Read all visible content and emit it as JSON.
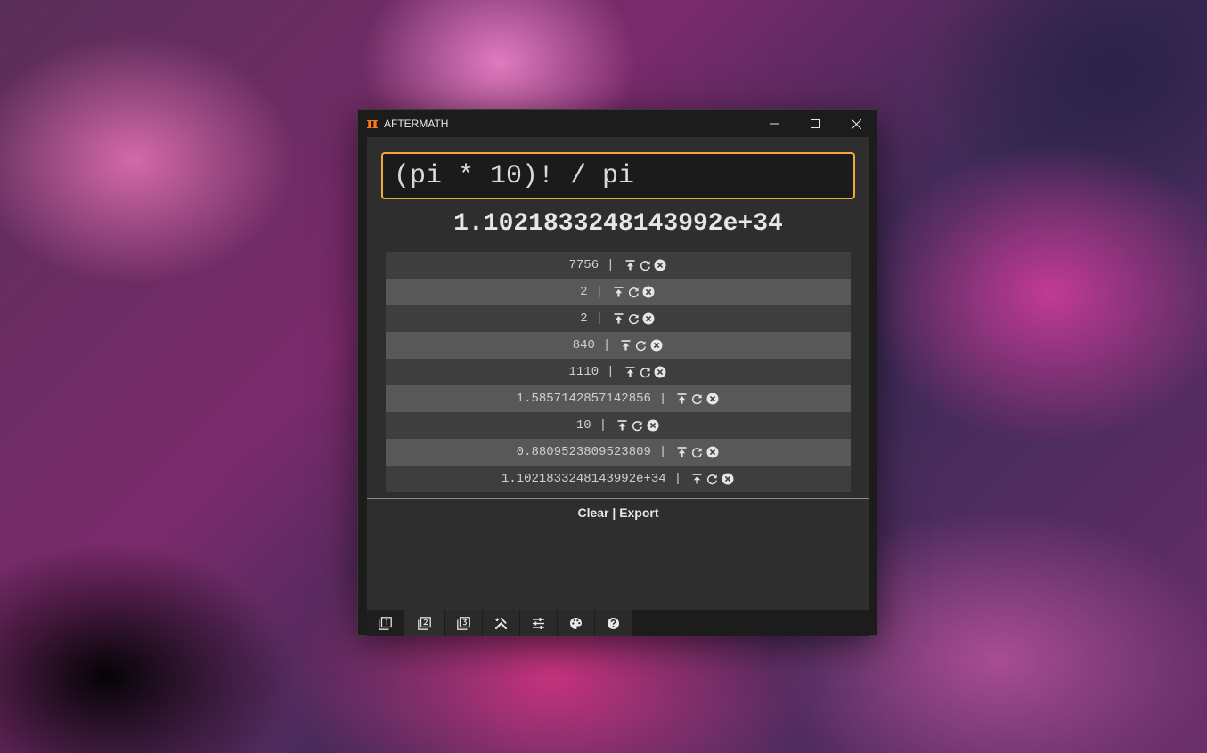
{
  "window": {
    "title": "AFTERMATH",
    "app_icon": "π",
    "controls": [
      "minimize-icon",
      "maximize-icon",
      "close-icon"
    ]
  },
  "calculator": {
    "expression": "(pi * 10)! / pi",
    "result": "1.1021833248143992e+34"
  },
  "history": {
    "separator": "|",
    "row_icons": [
      "move-to-top-icon",
      "recalculate-icon",
      "remove-icon"
    ],
    "items": [
      {
        "value": "7756"
      },
      {
        "value": "2"
      },
      {
        "value": "2"
      },
      {
        "value": "840"
      },
      {
        "value": "1110"
      },
      {
        "value": "1.5857142857142856"
      },
      {
        "value": "10"
      },
      {
        "value": "0.8809523809523809"
      },
      {
        "value": "1.1021833248143992e+34"
      }
    ]
  },
  "actions": {
    "clear_label": "Clear",
    "separator": "|",
    "export_label": "Export"
  },
  "tabs": [
    {
      "icon": "tab-1-icon",
      "active": false
    },
    {
      "icon": "tab-2-icon",
      "active": true
    },
    {
      "icon": "tab-3-icon",
      "active": false
    },
    {
      "icon": "tools-icon",
      "active": false
    },
    {
      "icon": "sliders-icon",
      "active": false
    },
    {
      "icon": "palette-icon",
      "active": false
    },
    {
      "icon": "help-icon",
      "active": false
    }
  ],
  "colors": {
    "accent": "#f2a93b",
    "brand": "#ff7b1a",
    "window_bg": "#1c1c1c",
    "content_bg": "#2e2e2e"
  }
}
